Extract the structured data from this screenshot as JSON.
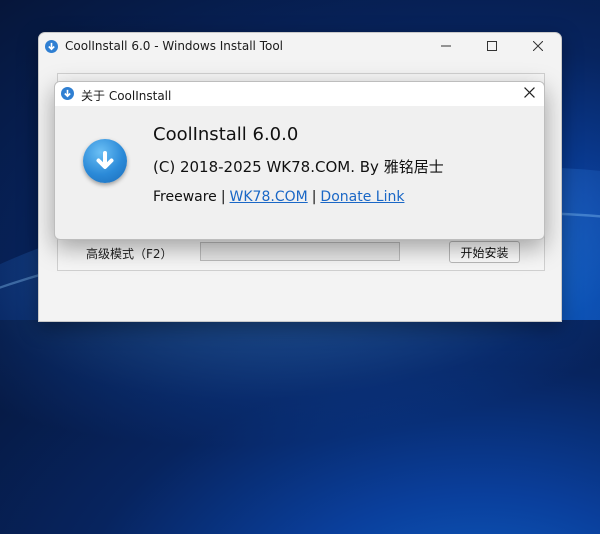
{
  "main_window": {
    "title": "CoolInstall 6.0 - Windows Install Tool",
    "advanced_mode_label": "高级模式（F2）",
    "start_install_button": "开始安装",
    "progress": 0
  },
  "about_dialog": {
    "title": "关于 CoolInstall",
    "app_name": "CoolInstall 6.0.0",
    "copyright": "(C) 2018-2025 WK78.COM. By 雅铭居士",
    "license": "Freeware",
    "separator": "|",
    "website_link": "WK78.COM",
    "donate_link": "Donate Link"
  },
  "icons": {
    "app_icon": "download-arrow-icon",
    "minimize": "minimize-icon",
    "maximize": "maximize-icon",
    "close": "close-icon"
  },
  "colors": {
    "accent": "#2f7fd2",
    "link": "#1a67c6"
  }
}
